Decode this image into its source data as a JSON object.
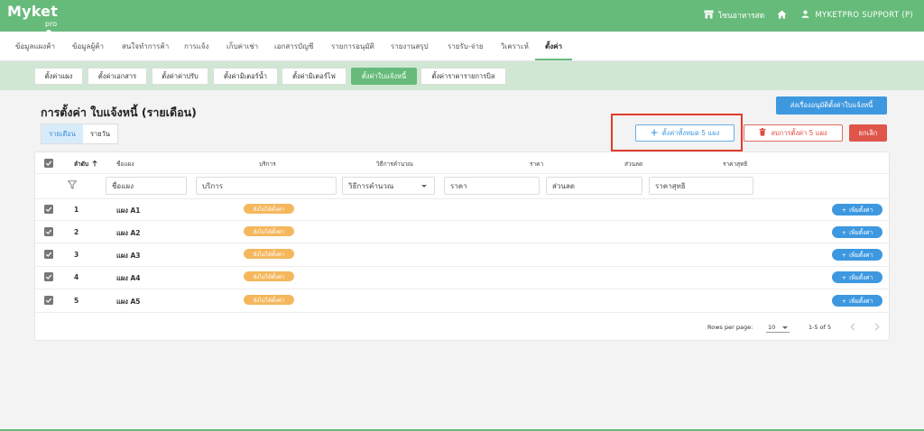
{
  "app": {
    "logo_text": "Myket",
    "logo_sub": "pro",
    "store_name": "โซนอาหารสด",
    "user_name": "MYKETPRO SUPPORT (P)"
  },
  "colors": {
    "brand_green": "#66bb7a",
    "sub_bar": "#cfe7d3",
    "primary_blue": "#3d98e0",
    "danger_red": "#e0554a",
    "badge_orange": "#f5b75e",
    "highlight_frame": "#e23b2e"
  },
  "nav": {
    "items": [
      {
        "label": "ข้อมูลแผงค้า"
      },
      {
        "label": "ข้อมูลผู้ค้า"
      },
      {
        "label": "สนใจทำการค้า"
      },
      {
        "label": "การแจ้ง"
      },
      {
        "label": "เก็บค่าเช่า"
      },
      {
        "label": "เอกสารบัญชี"
      },
      {
        "label": "รายการอนุมัติ"
      },
      {
        "label": "รายงานสรุป"
      },
      {
        "label": "รายรับ-จ่าย"
      },
      {
        "label": "วิเคราะห์"
      },
      {
        "label": "ตั้งค่า"
      }
    ],
    "active_index": 10
  },
  "subtabs": {
    "items": [
      {
        "label": "ตั้งค่าแผง"
      },
      {
        "label": "ตั้งค่าเอกสาร"
      },
      {
        "label": "ตั้งค่าค่าปรับ"
      },
      {
        "label": "ตั้งค่ามิเตอร์น้ำ"
      },
      {
        "label": "ตั้งค่ามิเตอร์ไฟ"
      },
      {
        "label": "ตั้งค่าใบแจ้งหนี้"
      },
      {
        "label": "ตั้งค่าราคารายการบิล"
      }
    ],
    "active_index": 5
  },
  "page": {
    "title": "การตั้งค่า ใบแจ้งหนี้ (รายเดือน)",
    "toggle_monthly": "รายเดือน",
    "toggle_daily": "รายวัน",
    "approve_button": "ส่งเรื่องอนุมัติตั้งค่าใบแจ้งหนี้",
    "set_all_button": "ตั้งค่าทั้งหมด 5 แผง",
    "delete_button": "ลบการตั้งค่า 5 แผง",
    "cancel_button": "ยกเลิก"
  },
  "table": {
    "headers": {
      "order": "ลำดับ",
      "stall": "ชื่อแผง",
      "service": "บริการ",
      "calc": "วิธีการคำนวณ",
      "price": "ราคา",
      "discount": "ส่วนลด",
      "net": "ราคาสุทธิ"
    },
    "filters": {
      "stall": "ชื่อแผง",
      "service": "บริการ",
      "calc": "วิธีการคำนวณ",
      "price": "ราคา",
      "discount": "ส่วนลด",
      "net": "ราคาสุทธิ"
    },
    "rows": [
      {
        "order": "1",
        "stall": "แผง A1",
        "status": "ยังไม่ได้ตั้งค่า",
        "action": "เพิ่มตั้งค่า"
      },
      {
        "order": "2",
        "stall": "แผง A2",
        "status": "ยังไม่ได้ตั้งค่า",
        "action": "เพิ่มตั้งค่า"
      },
      {
        "order": "3",
        "stall": "แผง A3",
        "status": "ยังไม่ได้ตั้งค่า",
        "action": "เพิ่มตั้งค่า"
      },
      {
        "order": "4",
        "stall": "แผง A4",
        "status": "ยังไม่ได้ตั้งค่า",
        "action": "เพิ่มตั้งค่า"
      },
      {
        "order": "5",
        "stall": "แผง A5",
        "status": "ยังไม่ได้ตั้งค่า",
        "action": "เพิ่มตั้งค่า"
      }
    ]
  },
  "pagination": {
    "rows_per_page_label": "Rows per page:",
    "rows_per_page_value": "10",
    "range_text": "1-5 of 5"
  }
}
